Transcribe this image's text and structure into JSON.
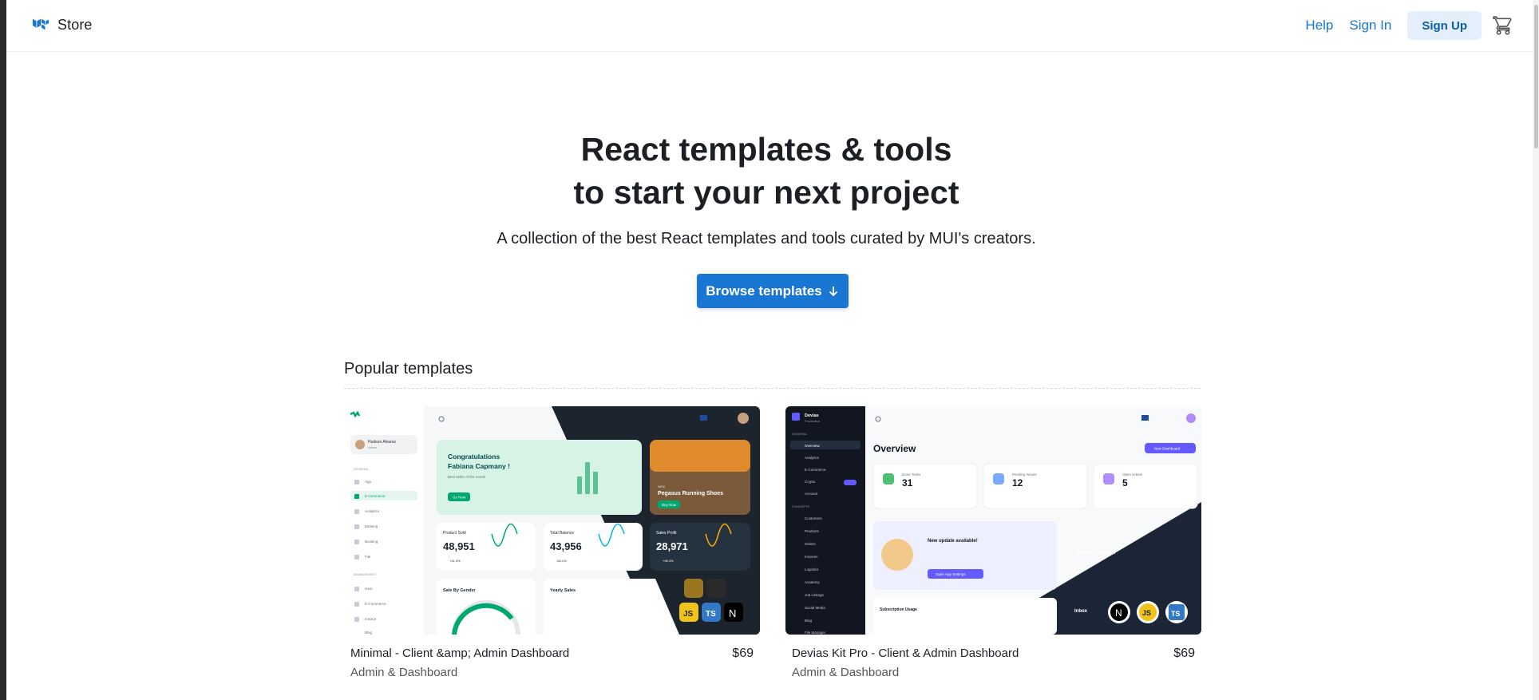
{
  "header": {
    "brand": "Store",
    "nav": {
      "help": "Help",
      "sign_in": "Sign In",
      "sign_up": "Sign Up"
    }
  },
  "hero": {
    "title_line1": "React templates & tools",
    "title_line2": "to start your next project",
    "subtitle": "A collection of the best React templates and tools curated by MUI's creators.",
    "cta": "Browse templates"
  },
  "popular": {
    "title": "Popular templates",
    "cards": [
      {
        "name": "Minimal - Client &amp; Admin Dashboard",
        "category": "Admin & Dashboard",
        "price": "$69",
        "preview": {
          "user": "Hudson Alvarez",
          "role": "Admin",
          "menu": [
            "App",
            "E-commerce",
            "Analytics",
            "Banking",
            "Booking",
            "File"
          ],
          "menu2": [
            "User",
            "E-Commerce",
            "Invoice",
            "Blog"
          ],
          "welcome_title": "Congratulations Fabiana Capmany !",
          "welcome_body": "Best seller of the month",
          "welcome_btn": "Go Now",
          "promo_tag": "NEW",
          "promo_title": "Pegasus Running Shoes",
          "promo_btn": "Buy Now",
          "stats": [
            {
              "label": "Product Sold",
              "value": "48,951",
              "change": "+41.3%"
            },
            {
              "label": "Total Balance",
              "value": "43,956",
              "change": "-63.1%"
            },
            {
              "label": "Sales Profit",
              "value": "28,971",
              "change": "+96.3%"
            }
          ],
          "bottom": [
            "Sale By Gender",
            "Yearly Sales"
          ]
        }
      },
      {
        "name": "Devias Kit Pro - Client & Admin Dashboard",
        "category": "Admin & Dashboard",
        "price": "$69",
        "preview": {
          "org": "Devias",
          "org_sub": "Production",
          "menu": [
            "Overview",
            "Analytics",
            "E-Commerce",
            "Crypto",
            "Account"
          ],
          "menu2": [
            "Customers",
            "Products",
            "Orders",
            "Invoices",
            "Logistics",
            "Academy",
            "Job Listings",
            "Social Media",
            "Blog",
            "File Manager"
          ],
          "heading": "Overview",
          "new_btn": "New Dashboard",
          "stats": [
            {
              "label": "Done Tasks",
              "value": "31"
            },
            {
              "label": "Pending Issues",
              "value": "12"
            },
            {
              "label": "Open tickets",
              "value": "5"
            }
          ],
          "update_title": "New update available!",
          "update_btn": "Open App Settings",
          "fresh": "New fresh design.",
          "usage": "Subscription Usage",
          "inbox": "Inbox"
        }
      }
    ]
  },
  "colors": {
    "primary": "#1976d2",
    "signup_bg": "#e3f0fc",
    "minimal_green": "#00a76f",
    "devias_purple": "#635bff"
  }
}
